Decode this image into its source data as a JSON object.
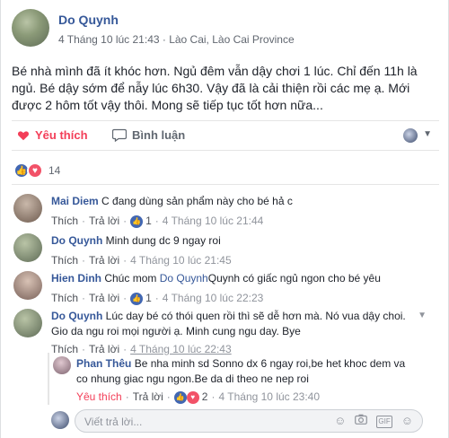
{
  "post": {
    "author": "Do Quynh",
    "meta": "4 Tháng 10 lúc 21:43 · Lào Cai, Lào Cai Province",
    "text": "Bé nhà mình đã ít khóc hơn. Ngủ đêm vẫn dậy chơi 1 lúc. Chỉ đến 11h là ngủ. Bé dậy sớm để nẫy lúc 6h30. Vậy đã là cải thiện rồi các mẹ ạ. Mới được 2 hôm tốt vậy thôi. Mong sẽ tiếp tục tốt hơn nữa..."
  },
  "actions": {
    "like": "Yêu thích",
    "comment": "Bình luận"
  },
  "reactions": {
    "count": "14"
  },
  "comments": [
    {
      "name": "Mai Diem",
      "text": "C đang dùng sản phẩm này cho bé hả c",
      "like": "Thích",
      "reply": "Trả lời",
      "likes": "1",
      "time": "4 Tháng 10 lúc 21:44"
    },
    {
      "name": "Do Quynh",
      "text": "Minh dung dc 9 ngay roi",
      "like": "Thích",
      "reply": "Trả lời",
      "time": "4 Tháng 10 lúc 21:45"
    },
    {
      "name": "Hien Dinh",
      "text_before": "Chúc mom",
      "mention": "Do Quynh",
      "text_after": "Quynh có giấc ngủ ngon cho bé yêu",
      "like": "Thích",
      "reply": "Trả lời",
      "likes": "1",
      "time": "4 Tháng 10 lúc 22:23"
    },
    {
      "name": "Do Quynh",
      "text": "Lúc day bé có thói quen rồi thì sẽ dễ hơn mà. Nó vua dậy choi. Gio da ngu roi mọi người ạ. Minh cung ngu day. Bye",
      "like": "Thích",
      "reply": "Trả lời",
      "time": "4 Tháng 10 lúc 22:43"
    }
  ],
  "reply": {
    "name": "Phan Thêu",
    "text": "Be nha minh sd Sonno dx 6 ngay roi,be het khoc dem va co nhung giac ngu ngon.Be da di theo ne nep roi",
    "like": "Yêu thích",
    "reply": "Trả lời",
    "likes": "2",
    "time": "4 Tháng 10 lúc 23:40"
  },
  "write_reply": {
    "placeholder": "Viết trả lời..."
  },
  "icons": {
    "globe": "globe-icon",
    "like": "heart-icon",
    "comment": "speech-bubble-icon",
    "emoji": "smiley-icon",
    "camera": "camera-icon",
    "gif": "gif-icon",
    "sticker": "sticker-icon"
  },
  "colors": {
    "link": "#365899",
    "love": "#f33e58",
    "like": "#4267b2"
  }
}
